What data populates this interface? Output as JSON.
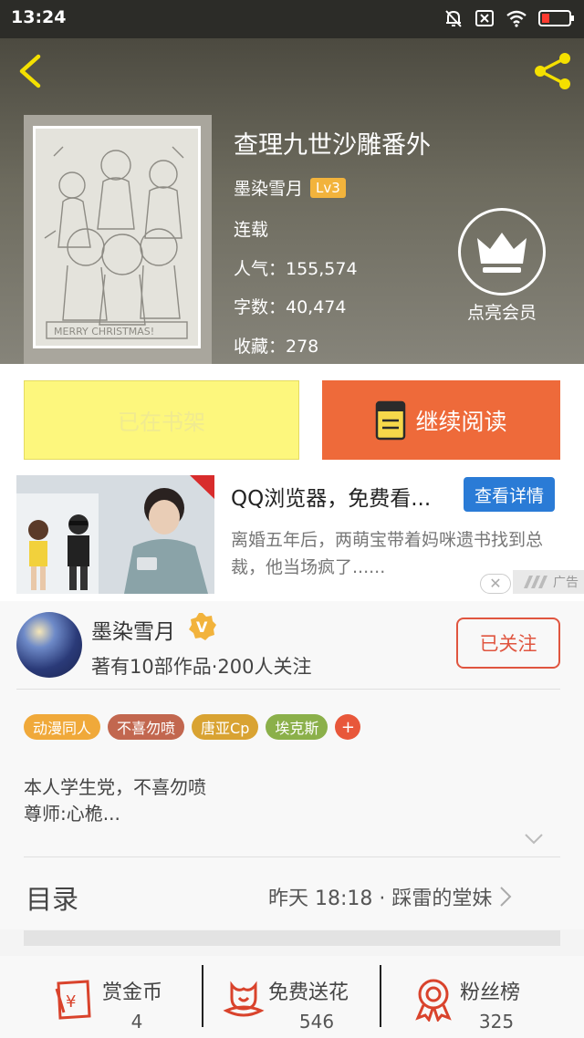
{
  "status_bar": {
    "time": "13:24"
  },
  "book": {
    "title": "查理九世沙雕番外",
    "author": "墨染雪月",
    "level": "Lv3",
    "status": "连载",
    "popularity": "人气：155,574",
    "word_count": "字数：40,474",
    "favorites": "收藏：278",
    "vip_label": "点亮会员"
  },
  "actions": {
    "shelf_label": "已在书架",
    "read_label": "继续阅读"
  },
  "ad": {
    "title": "QQ浏览器，免费看...",
    "button": "查看详情",
    "description": "离婚五年后，两萌宝带着妈咪遗书找到总裁，他当场疯了......",
    "tag": "广告"
  },
  "author_profile": {
    "name": "墨染雪月",
    "stats": "著有10部作品·200人关注",
    "follow_label": "已关注",
    "tags": [
      {
        "label": "动漫同人",
        "color": "#f0a93a"
      },
      {
        "label": "不喜勿喷",
        "color": "#c2674f"
      },
      {
        "label": "唐亚Cp",
        "color": "#d9a332"
      },
      {
        "label": "埃克斯",
        "color": "#8bb04a"
      }
    ],
    "tag_add": "+",
    "bio_lines": [
      "本人学生党，不喜勿喷",
      "尊师:心桅..."
    ]
  },
  "toc": {
    "label": "目录",
    "latest": "昨天 18:18 · 踩雷的堂妹"
  },
  "bottom_bar": [
    {
      "label": "赏金币",
      "count": "4",
      "icon": "reward-coin-icon"
    },
    {
      "label": "免费送花",
      "count": "546",
      "icon": "flower-icon"
    },
    {
      "label": "粉丝榜",
      "count": "325",
      "icon": "medal-icon"
    }
  ],
  "colors": {
    "accent": "#ee6a3a",
    "shelf_button": "#fdf77d",
    "ad_button": "#2a7bd6",
    "follow": "#e0553f",
    "bottom_icon": "#d9432c"
  }
}
